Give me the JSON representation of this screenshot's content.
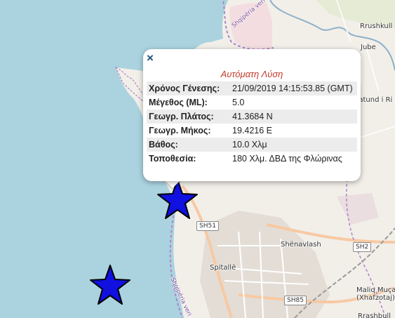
{
  "popup": {
    "close_symbol": "×",
    "title": "Αυτόματη Λύση",
    "rows": [
      {
        "label": "Χρόνος Γένεσης:",
        "value": "21/09/2019 14:15:53.85 (GMT)"
      },
      {
        "label": "Μέγεθος (ML):",
        "value": "5.0"
      },
      {
        "label": "Γεωγρ. Πλάτος:",
        "value": "41.3684 N"
      },
      {
        "label": "Γεωγρ. Μήκος:",
        "value": "19.4216 E"
      },
      {
        "label": "Βάθος:",
        "value": "10.0 Χλμ"
      },
      {
        "label": "Τοποθεσία:",
        "value": "180 Χλμ. ΔΒΔ της Φλώρινας"
      }
    ]
  },
  "map": {
    "places": [
      "Rrushkull",
      "Jube",
      "Katund i Ri",
      "Shënavlash",
      "Spitallë",
      "Maliq Muça",
      "(Xhafzotaj)",
      "Rrashbull"
    ],
    "roads": [
      "SH51",
      "SH2",
      "SH85"
    ],
    "boundary_labels": [
      "Shqipëria veri",
      "Shqipëria veri"
    ],
    "markers": [
      {
        "name": "earthquake-epicenter-star",
        "color": "#1010e0"
      },
      {
        "name": "earthquake-star",
        "color": "#1010e0"
      }
    ],
    "colors": {
      "sea": "#aad3df",
      "land": "#f2efe9",
      "boundary": "#b084c8",
      "star": "#1010e0"
    }
  }
}
